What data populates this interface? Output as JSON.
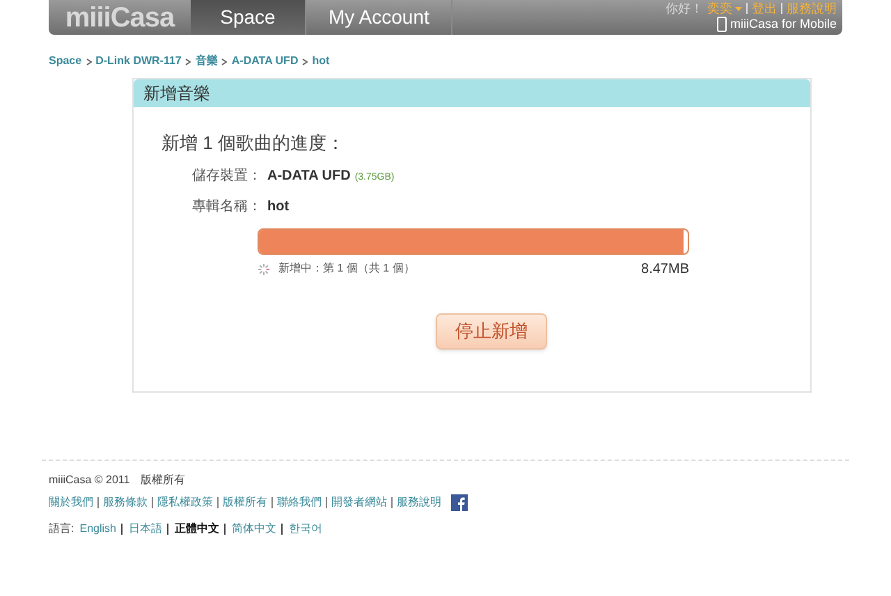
{
  "header": {
    "logo": "miiiCasa",
    "tabs": [
      {
        "label": "Space",
        "selected": true
      },
      {
        "label": "My Account",
        "selected": false
      }
    ],
    "greeting": "你好！",
    "user": "奕奕",
    "links": [
      "登出",
      "服務說明"
    ],
    "mobile_link": "miiiCasa for Mobile"
  },
  "breadcrumb": [
    "Space",
    "D-Link DWR-117",
    "音樂",
    "A-DATA UFD",
    "hot"
  ],
  "card": {
    "title": "新增音樂",
    "heading": "新增 1 個歌曲的進度：",
    "fields": [
      {
        "label": "儲存裝置：",
        "value": "A-DATA UFD",
        "note": "(3.75GB)"
      },
      {
        "label": "專輯名稱：",
        "value": "hot"
      }
    ],
    "progress": {
      "level": 0.99,
      "status": "新增中：第 1 個（共 1 個）",
      "size": "8.47MB"
    },
    "button": "停止新增"
  },
  "footer": {
    "copyright": "miiiCasa © 2011",
    "rights": "版權所有",
    "links": [
      "關於我們",
      "服務條款",
      "隱私權政策",
      "版權所有",
      "聯絡我們",
      "開發者網站",
      "服務說明"
    ],
    "language_label": "語言:",
    "languages": [
      {
        "label": "English",
        "selected": false
      },
      {
        "label": "日本語",
        "selected": false
      },
      {
        "label": "正體中文",
        "selected": true
      },
      {
        "label": "简体中文",
        "selected": false
      },
      {
        "label": "한국어",
        "selected": false
      }
    ]
  }
}
